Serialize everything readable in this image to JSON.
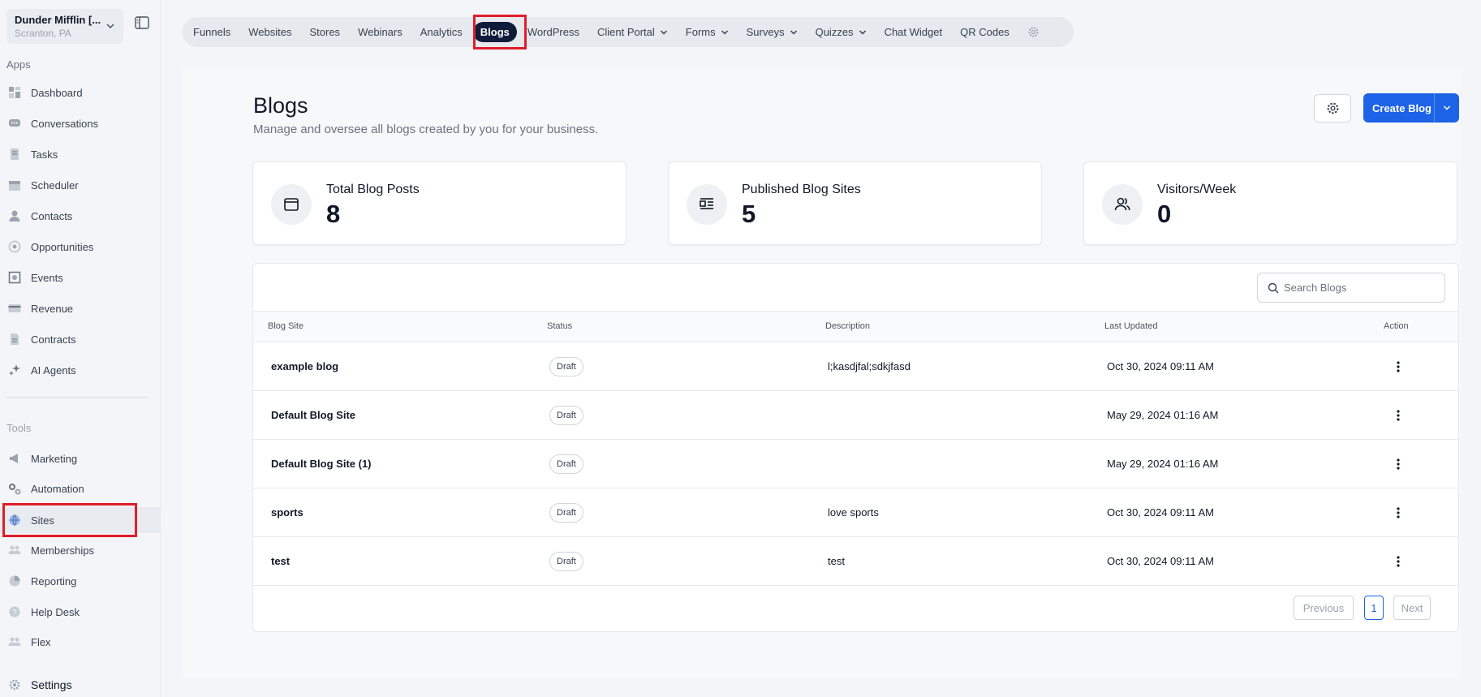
{
  "account": {
    "name": "Dunder Mifflin [...",
    "location": "Scranton, PA"
  },
  "sidebar": {
    "apps_label": "Apps",
    "apps": [
      {
        "label": "Dashboard",
        "icon": "dashboard-icon"
      },
      {
        "label": "Conversations",
        "icon": "chat-icon"
      },
      {
        "label": "Tasks",
        "icon": "tasks-icon"
      },
      {
        "label": "Scheduler",
        "icon": "calendar-icon"
      },
      {
        "label": "Contacts",
        "icon": "person-icon"
      },
      {
        "label": "Opportunities",
        "icon": "target-icon"
      },
      {
        "label": "Events",
        "icon": "events-icon"
      },
      {
        "label": "Revenue",
        "icon": "card-icon"
      },
      {
        "label": "Contracts",
        "icon": "document-icon"
      },
      {
        "label": "AI Agents",
        "icon": "sparkle-icon"
      }
    ],
    "tools_label": "Tools",
    "tools": [
      {
        "label": "Marketing",
        "icon": "megaphone-icon"
      },
      {
        "label": "Automation",
        "icon": "gears-icon"
      },
      {
        "label": "Sites",
        "icon": "globe-icon",
        "active": true
      },
      {
        "label": "Memberships",
        "icon": "members-icon"
      },
      {
        "label": "Reporting",
        "icon": "pie-icon"
      },
      {
        "label": "Help Desk",
        "icon": "help-icon"
      },
      {
        "label": "Flex",
        "icon": "flex-icon"
      }
    ],
    "settings_label": "Settings"
  },
  "topnav": {
    "items": [
      {
        "label": "Funnels"
      },
      {
        "label": "Websites"
      },
      {
        "label": "Stores"
      },
      {
        "label": "Webinars"
      },
      {
        "label": "Analytics"
      },
      {
        "label": "Blogs",
        "active": true
      },
      {
        "label": "WordPress"
      },
      {
        "label": "Client Portal",
        "dropdown": true
      },
      {
        "label": "Forms",
        "dropdown": true
      },
      {
        "label": "Surveys",
        "dropdown": true
      },
      {
        "label": "Quizzes",
        "dropdown": true
      },
      {
        "label": "Chat Widget"
      },
      {
        "label": "QR Codes"
      }
    ]
  },
  "page": {
    "title": "Blogs",
    "subtitle": "Manage and oversee all blogs created by you for your business.",
    "create_label": "Create Blog"
  },
  "stats": [
    {
      "label": "Total Blog Posts",
      "value": "8",
      "icon": "browser-icon"
    },
    {
      "label": "Published Blog Sites",
      "value": "5",
      "icon": "article-icon"
    },
    {
      "label": "Visitors/Week",
      "value": "0",
      "icon": "users-icon"
    }
  ],
  "table": {
    "search_placeholder": "Search Blogs",
    "headers": {
      "site": "Blog Site",
      "status": "Status",
      "description": "Description",
      "updated": "Last Updated",
      "action": "Action"
    },
    "rows": [
      {
        "site": "example blog",
        "status": "Draft",
        "description": "l;kasdjfal;sdkjfasd",
        "updated": "Oct 30, 2024 09:11 AM"
      },
      {
        "site": "Default Blog Site",
        "status": "Draft",
        "description": "",
        "updated": "May 29, 2024 01:16 AM"
      },
      {
        "site": "Default Blog Site (1)",
        "status": "Draft",
        "description": "",
        "updated": "May 29, 2024 01:16 AM"
      },
      {
        "site": "sports",
        "status": "Draft",
        "description": "love sports",
        "updated": "Oct 30, 2024 09:11 AM"
      },
      {
        "site": "test",
        "status": "Draft",
        "description": "test",
        "updated": "Oct 30, 2024 09:11 AM"
      }
    ],
    "pagination": {
      "previous": "Previous",
      "current": "1",
      "next": "Next"
    }
  },
  "colors": {
    "accent": "#1d63e8",
    "active_tab": "#0f1b3a",
    "highlight": "#e11d2a"
  }
}
